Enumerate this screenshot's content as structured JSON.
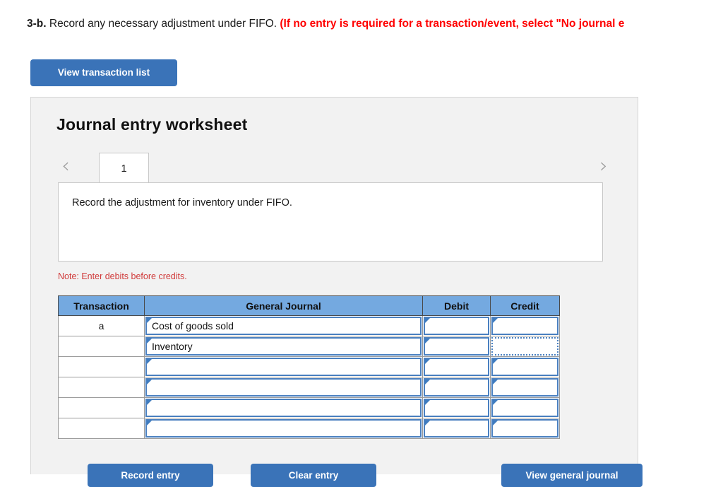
{
  "question": {
    "number": "3-b.",
    "text": "Record any necessary adjustment under FIFO.",
    "red_note": "(If no entry is required for a transaction/event, select \"No journal e"
  },
  "toolbar": {
    "view_transaction_list": "View transaction list"
  },
  "worksheet": {
    "title": "Journal entry worksheet",
    "prev_arrow": "‹",
    "next_arrow": "›",
    "tabs": [
      {
        "label": "1",
        "active": true
      }
    ],
    "instruction": "Record the adjustment for inventory under FIFO.",
    "note": "Note: Enter debits before credits."
  },
  "table": {
    "headers": {
      "transaction": "Transaction",
      "general_journal": "General Journal",
      "debit": "Debit",
      "credit": "Credit"
    },
    "rows": [
      {
        "transaction": "a",
        "account": "Cost of goods sold",
        "debit": "",
        "credit": "",
        "credit_focused": false
      },
      {
        "transaction": "",
        "account": "Inventory",
        "debit": "",
        "credit": "",
        "credit_focused": true
      },
      {
        "transaction": "",
        "account": "",
        "debit": "",
        "credit": "",
        "credit_focused": false
      },
      {
        "transaction": "",
        "account": "",
        "debit": "",
        "credit": "",
        "credit_focused": false
      },
      {
        "transaction": "",
        "account": "",
        "debit": "",
        "credit": "",
        "credit_focused": false
      },
      {
        "transaction": "",
        "account": "",
        "debit": "",
        "credit": "",
        "credit_focused": false
      }
    ]
  },
  "footer": {
    "record_entry": "Record entry",
    "clear_entry": "Clear entry",
    "view_general_journal": "View general journal"
  },
  "colors": {
    "button_blue": "#3a73b8",
    "header_blue": "#74a9e0",
    "input_border_blue": "#4a80c0",
    "red": "#ff0000",
    "note_red": "#d03a3a",
    "panel_gray": "#f2f2f2"
  }
}
